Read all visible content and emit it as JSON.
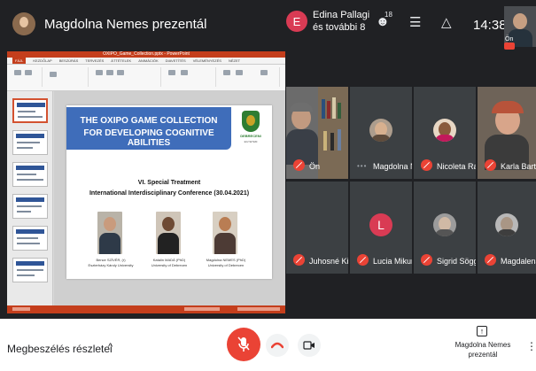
{
  "top_bar": {
    "presenter_name": "Magdolna Nemes prezentál",
    "participants_chip": {
      "initial": "E",
      "line1": "Edina Pallagi",
      "line2": "és további 8"
    },
    "people_count": "18",
    "clock": "14:38",
    "self_label": "Ön"
  },
  "presentation": {
    "window_title": "OXIPO_Game_Collection.pptx - PowerPoint",
    "ribbon_tabs": [
      "FÁJL",
      "KEZDŐLAP",
      "BESZÚRÁS",
      "TERVEZÉS",
      "ÁTTÉTELEK",
      "ANIMÁCIÓK",
      "DIAVETÍTÉS",
      "VÉLEMÉNYEZÉS",
      "NÉZET"
    ],
    "slide": {
      "title_line1": "THE OXIPO GAME COLLECTION",
      "title_line2": "FOR DEVELOPING COGNITIVE ABILITIES",
      "logo_text": "DEBRECENI",
      "logo_sub": "EGYETEM",
      "conference_line1": "VI. Special Treatment",
      "conference_line2": "International Interdisciplinary Conference (30.04.2021)",
      "speakers": [
        {
          "name": "Bence SZÍVÉR, (r)",
          "affiliation": "Eszterházy Károly University"
        },
        {
          "name": "Katalin MADÁ (PhD)",
          "affiliation": "University of Debrecen"
        },
        {
          "name": "Magdolna NEMES (PhD)",
          "affiliation": "University of Debrecen"
        }
      ]
    }
  },
  "participants": [
    {
      "name": "Ön",
      "muted": true
    },
    {
      "name": "Magdolna N...",
      "muted": false
    },
    {
      "name": "Nicoleta Ra...",
      "muted": true
    },
    {
      "name": "Karla Barth",
      "muted": true
    },
    {
      "name": "Juhosné Kis...",
      "muted": true
    },
    {
      "name": "Lucia Mikurc...",
      "muted": true,
      "initial": "L"
    },
    {
      "name": "Sigrid Söggel",
      "muted": true
    },
    {
      "name": "Magdalena ...",
      "muted": true
    }
  ],
  "bottom_bar": {
    "meeting_details": "Megbeszélés részletei",
    "chevron": "^",
    "present_line1": "Magdolna Nemes",
    "present_line2": "prezentál",
    "more": "⋮"
  },
  "colors": {
    "accent_red": "#ea4335",
    "tile_bg": "#3c4043",
    "slide_banner": "#3f6dba"
  }
}
